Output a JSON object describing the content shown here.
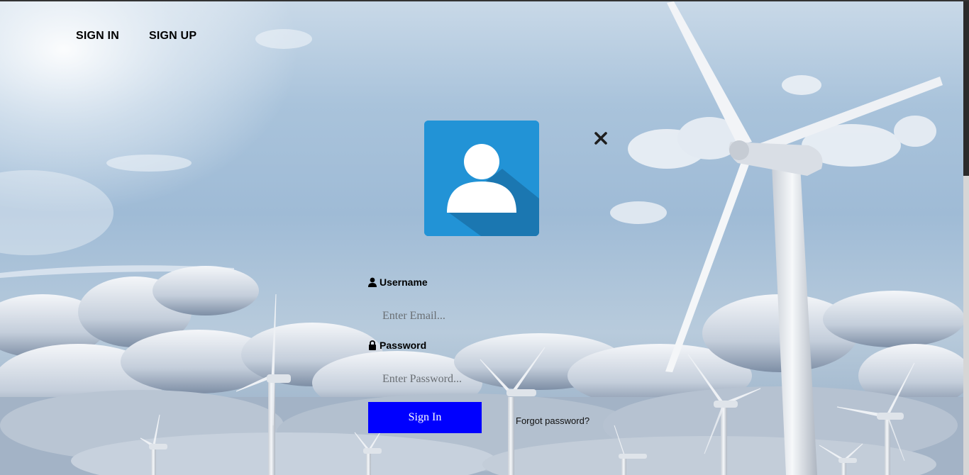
{
  "nav": {
    "sign_in": "SIGN IN",
    "sign_up": "SIGN UP"
  },
  "avatar": {
    "icon": "user-avatar-icon",
    "color": "#2293d6"
  },
  "close": {
    "icon": "close-icon"
  },
  "form": {
    "username_label": "Username",
    "username_icon": "user-icon",
    "email_placeholder": "Enter Email...",
    "password_label": "Password",
    "password_icon": "lock-icon",
    "password_placeholder": "Enter Password...",
    "submit_label": "Sign In",
    "forgot_label": "Forgot password?"
  },
  "colors": {
    "submit_button": "#0000ff",
    "avatar_bg": "#2293d6"
  }
}
